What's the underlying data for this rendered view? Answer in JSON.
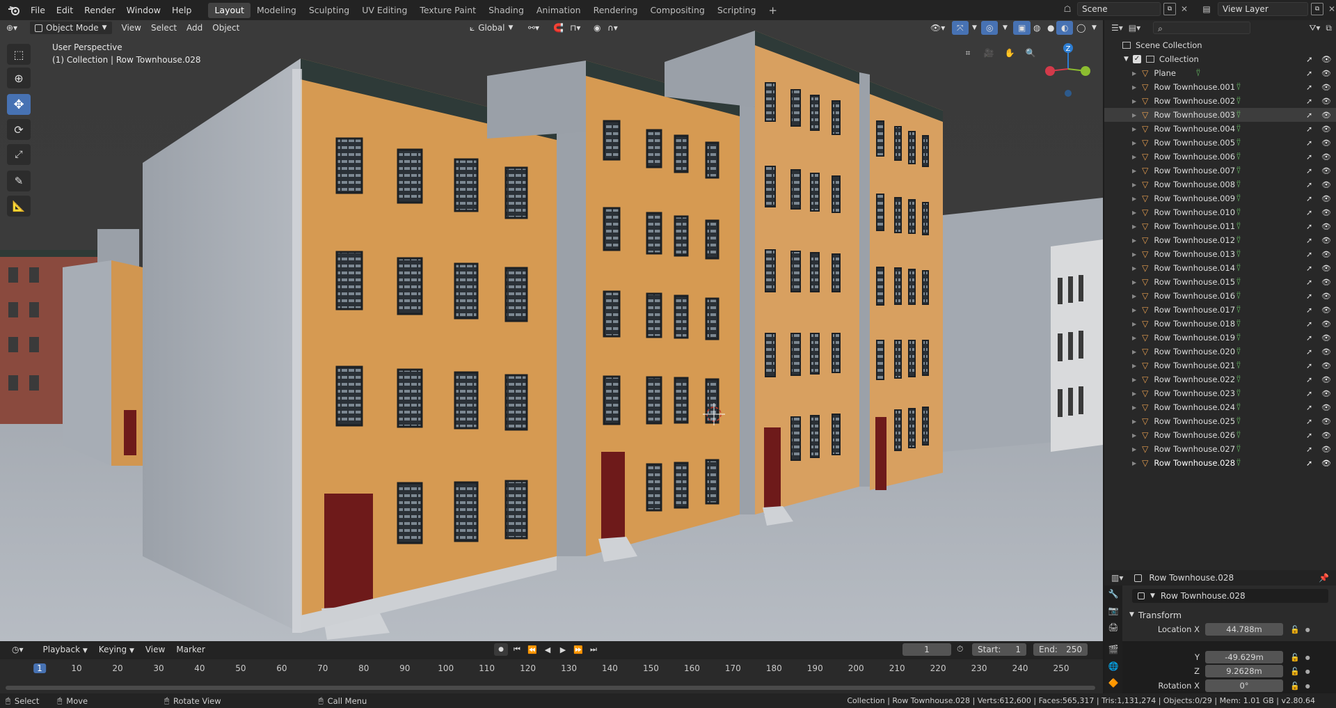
{
  "menus": [
    "File",
    "Edit",
    "Render",
    "Window",
    "Help"
  ],
  "workspaces": [
    "Layout",
    "Modeling",
    "Sculpting",
    "UV Editing",
    "Texture Paint",
    "Shading",
    "Animation",
    "Rendering",
    "Compositing",
    "Scripting"
  ],
  "active_workspace": "Layout",
  "scene": "Scene",
  "view_layer": "View Layer",
  "viewport": {
    "mode": "Object Mode",
    "menus": [
      "View",
      "Select",
      "Add",
      "Object"
    ],
    "orientation": "Global",
    "perspective_label": "User Perspective",
    "collection_label": "(1) Collection | Row Townhouse.028",
    "gizmo_z": "Z"
  },
  "outliner": {
    "scene_collection": "Scene Collection",
    "collection": "Collection",
    "items": [
      "Plane",
      "Row Townhouse.001",
      "Row Townhouse.002",
      "Row Townhouse.003",
      "Row Townhouse.004",
      "Row Townhouse.005",
      "Row Townhouse.006",
      "Row Townhouse.007",
      "Row Townhouse.008",
      "Row Townhouse.009",
      "Row Townhouse.010",
      "Row Townhouse.011",
      "Row Townhouse.012",
      "Row Townhouse.013",
      "Row Townhouse.014",
      "Row Townhouse.015",
      "Row Townhouse.016",
      "Row Townhouse.017",
      "Row Townhouse.018",
      "Row Townhouse.019",
      "Row Townhouse.020",
      "Row Townhouse.021",
      "Row Townhouse.022",
      "Row Townhouse.023",
      "Row Townhouse.024",
      "Row Townhouse.025",
      "Row Townhouse.026",
      "Row Townhouse.027",
      "Row Townhouse.028"
    ],
    "highlighted": "Row Townhouse.003",
    "active": "Row Townhouse.028"
  },
  "properties": {
    "object_name": "Row Townhouse.028",
    "name_field": "Row Townhouse.028",
    "panel": "Transform",
    "location_x_label": "Location X",
    "location_x": "44.788m",
    "y_label": "Y",
    "location_y": "-49.629m",
    "z_label": "Z",
    "location_z": "9.2628m",
    "rotation_x_label": "Rotation X",
    "rotation_x": "0°"
  },
  "timeline": {
    "menus": [
      "Playback",
      "Keying",
      "View",
      "Marker"
    ],
    "current_frame": "1",
    "start_label": "Start:",
    "start": "1",
    "end_label": "End:",
    "end": "250",
    "ticks": [
      "1",
      "10",
      "20",
      "30",
      "40",
      "50",
      "60",
      "70",
      "80",
      "90",
      "100",
      "110",
      "120",
      "130",
      "140",
      "150",
      "160",
      "170",
      "180",
      "190",
      "200",
      "210",
      "220",
      "230",
      "240",
      "250"
    ]
  },
  "status": {
    "select": "Select",
    "move": "Move",
    "rotate_view": "Rotate View",
    "call_menu": "Call Menu",
    "stats": "Collection | Row Townhouse.028 | Verts:612,600 | Faces:565,317 | Tris:1,131,274 | Objects:0/29 | Mem: 1.01 GB | v2.80.64"
  },
  "colors": {
    "accent": "#4772b3",
    "facade": "#d69a52",
    "concrete": "#a8adb4",
    "door": "#6e1a1a"
  }
}
